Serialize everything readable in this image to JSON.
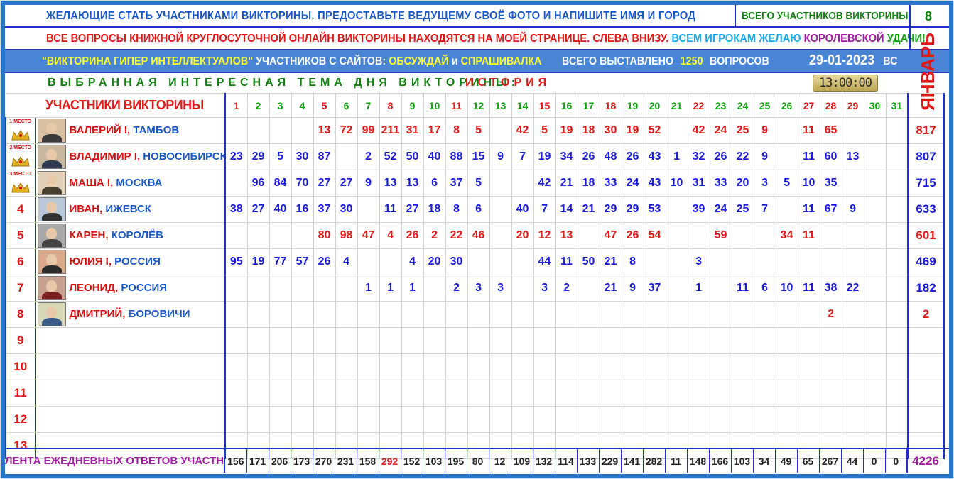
{
  "header": {
    "line1": "ЖЕЛАЮЩИЕ СТАТЬ УЧАСТНИКАМИ ВИКТОРИНЫ. ПРЕДОСТАВЬТЕ ВЕДУЩЕМУ СВОЁ ФОТО И НАПИШИТЕ ИМЯ И ГОРОД",
    "total_label": "ВСЕГО УЧАСТНИКОВ ВИКТОРИНЫ:",
    "total_value": "8",
    "line2_red": "ВСЕ ВОПРОСЫ КНИЖНОЙ КРУГЛОСУТОЧНОЙ ОНЛАЙН ВИКТОРИНЫ НАХОДЯТСЯ НА МОЕЙ СТРАНИЦЕ. СЛЕВА ВНИЗУ.",
    "line2_a": "ВСЕМ ИГРОКАМ ЖЕЛАЮ",
    "line2_b": "КОРОЛЕВСКОЙ",
    "line2_c": "УДАЧИ!",
    "quiz_name": "\"ВИКТОРИНА ГИПЕР ИНТЕЛЛЕКТУАЛОВ\"",
    "from_sites": "УЧАСТНИКОВ С САЙТОВ:",
    "site1": "ОБСУЖДАЙ",
    "and": "и",
    "site2": "СПРАШИВАЛКА",
    "total_q_label": "ВСЕГО ВЫСТАВЛЕНО",
    "total_q_value": "1250",
    "questions_word": "ВОПРОСОВ",
    "date": "29-01-2023",
    "weekday": "ВС",
    "theme_label": "ВЫБРАННАЯ ИНТЕРЕСНАЯ ТЕМА ДНЯ ВИКТОРИНЫ:",
    "theme_value": "ИСТОРИЯ",
    "clock": "13:00:00",
    "month": "ЯНВАРЬ",
    "participants_title": "УЧАСТНИКИ ВИКТОРИНЫ"
  },
  "days": [
    "1",
    "2",
    "3",
    "4",
    "5",
    "6",
    "7",
    "8",
    "9",
    "10",
    "11",
    "12",
    "13",
    "14",
    "15",
    "16",
    "17",
    "18",
    "19",
    "20",
    "21",
    "22",
    "23",
    "24",
    "25",
    "26",
    "27",
    "28",
    "29",
    "30",
    "31"
  ],
  "day_colors": [
    "red",
    "green",
    "green",
    "green",
    "red",
    "green",
    "green",
    "red",
    "green",
    "green",
    "red",
    "green",
    "green",
    "green",
    "red",
    "green",
    "green",
    "red",
    "green",
    "green",
    "green",
    "red",
    "green",
    "green",
    "green",
    "green",
    "red",
    "red",
    "red",
    "green",
    "green"
  ],
  "medals": [
    "1 МЕСТО",
    "2 МЕСТО",
    "3 МЕСТО"
  ],
  "participants": [
    {
      "place": "1",
      "name": "ВАЛЕРИЙ І,",
      "city": "ТАМБОВ",
      "total": "817",
      "scores": [
        "",
        "",
        "",
        "",
        "13",
        "72",
        "99",
        "211",
        "31",
        "17",
        "8",
        "5",
        "",
        "42",
        "5",
        "19",
        "18",
        "30",
        "19",
        "52",
        "",
        "42",
        "24",
        "25",
        "9",
        "",
        "11",
        "65",
        "",
        "",
        ""
      ],
      "color": "red"
    },
    {
      "place": "2",
      "name": "ВЛАДИМИР І,",
      "city": "НОВОСИБИРСК",
      "total": "807",
      "scores": [
        "23",
        "29",
        "5",
        "30",
        "87",
        "",
        "2",
        "52",
        "50",
        "40",
        "88",
        "15",
        "9",
        "7",
        "19",
        "34",
        "26",
        "48",
        "26",
        "43",
        "1",
        "32",
        "26",
        "22",
        "9",
        "",
        "11",
        "60",
        "13",
        "",
        ""
      ],
      "color": "blue"
    },
    {
      "place": "3",
      "name": "МАША І,",
      "city": "МОСКВА",
      "total": "715",
      "scores": [
        "",
        "96",
        "84",
        "70",
        "27",
        "27",
        "9",
        "13",
        "13",
        "6",
        "37",
        "5",
        "",
        "",
        "42",
        "21",
        "18",
        "33",
        "24",
        "43",
        "10",
        "31",
        "33",
        "20",
        "3",
        "5",
        "10",
        "35",
        "",
        "",
        ""
      ],
      "color": "blue"
    },
    {
      "place": "4",
      "name": "ИВАН,",
      "city": "ИЖЕВСК",
      "total": "633",
      "scores": [
        "38",
        "27",
        "40",
        "16",
        "37",
        "30",
        "",
        "11",
        "27",
        "18",
        "8",
        "6",
        "",
        "40",
        "7",
        "14",
        "21",
        "29",
        "29",
        "53",
        "",
        "39",
        "24",
        "25",
        "7",
        "",
        "11",
        "67",
        "9",
        "",
        ""
      ],
      "color": "blue"
    },
    {
      "place": "5",
      "name": "КАРЕН,",
      "city": "КОРОЛЁВ",
      "total": "601",
      "scores": [
        "",
        "",
        "",
        "",
        "80",
        "98",
        "47",
        "4",
        "26",
        "2",
        "22",
        "46",
        "",
        "20",
        "12",
        "13",
        "",
        "47",
        "26",
        "54",
        "",
        "",
        "59",
        "",
        "",
        "34",
        "11",
        "",
        "",
        "",
        ""
      ],
      "color": "red"
    },
    {
      "place": "6",
      "name": "ЮЛИЯ І,",
      "city": "РОССИЯ",
      "total": "469",
      "scores": [
        "95",
        "19",
        "77",
        "57",
        "26",
        "4",
        "",
        "",
        "4",
        "20",
        "30",
        "",
        "",
        "",
        "44",
        "11",
        "50",
        "21",
        "8",
        "",
        "",
        "3",
        "",
        "",
        "",
        "",
        "",
        "",
        "",
        "",
        ""
      ],
      "color": "blue"
    },
    {
      "place": "7",
      "name": "ЛЕОНИД,",
      "city": "РОССИЯ",
      "total": "182",
      "scores": [
        "",
        "",
        "",
        "",
        "",
        "",
        "1",
        "1",
        "1",
        "",
        "2",
        "3",
        "3",
        "",
        "3",
        "2",
        "",
        "21",
        "9",
        "37",
        "",
        "1",
        "",
        "11",
        "6",
        "10",
        "11",
        "38",
        "22",
        "",
        ""
      ],
      "color": "blue"
    },
    {
      "place": "8",
      "name": "ДМИТРИЙ,",
      "city": "БОРОВИЧИ",
      "total": "2",
      "scores": [
        "",
        "",
        "",
        "",
        "",
        "",
        "",
        "",
        "",
        "",
        "",
        "",
        "",
        "",
        "",
        "",
        "",
        "",
        "",
        "",
        "",
        "",
        "",
        "",
        "",
        "",
        "",
        "2",
        "",
        "",
        ""
      ],
      "color": "red"
    },
    {
      "place": "9",
      "name": "",
      "city": "",
      "total": "",
      "scores": [],
      "color": "blue"
    },
    {
      "place": "10",
      "name": "",
      "city": "",
      "total": "",
      "scores": [],
      "color": "blue"
    },
    {
      "place": "11",
      "name": "",
      "city": "",
      "total": "",
      "scores": [],
      "color": "blue"
    },
    {
      "place": "12",
      "name": "",
      "city": "",
      "total": "",
      "scores": [],
      "color": "blue"
    },
    {
      "place": "13",
      "name": "",
      "city": "",
      "total": "",
      "scores": [],
      "color": "blue"
    }
  ],
  "footer": {
    "label": "ЛЕНТА ЕЖЕДНЕВНЫХ ОТВЕТОВ УЧАСТНИКОВ",
    "daily": [
      "156",
      "171",
      "206",
      "173",
      "270",
      "231",
      "158",
      "292",
      "152",
      "103",
      "195",
      "80",
      "12",
      "109",
      "132",
      "114",
      "133",
      "229",
      "141",
      "282",
      "11",
      "148",
      "166",
      "103",
      "34",
      "49",
      "65",
      "267",
      "44",
      "0",
      "0"
    ],
    "highlight_index": 7,
    "grand_total": "4226"
  },
  "colors": {
    "frame": "#2a74c8",
    "grid_line": "#1e33c8",
    "title_blue": "#1a58c8",
    "red": "#e01818",
    "green": "#10a010",
    "yellow": "#ffff30",
    "banner": "#4a84d4",
    "purple": "#a020a0"
  }
}
